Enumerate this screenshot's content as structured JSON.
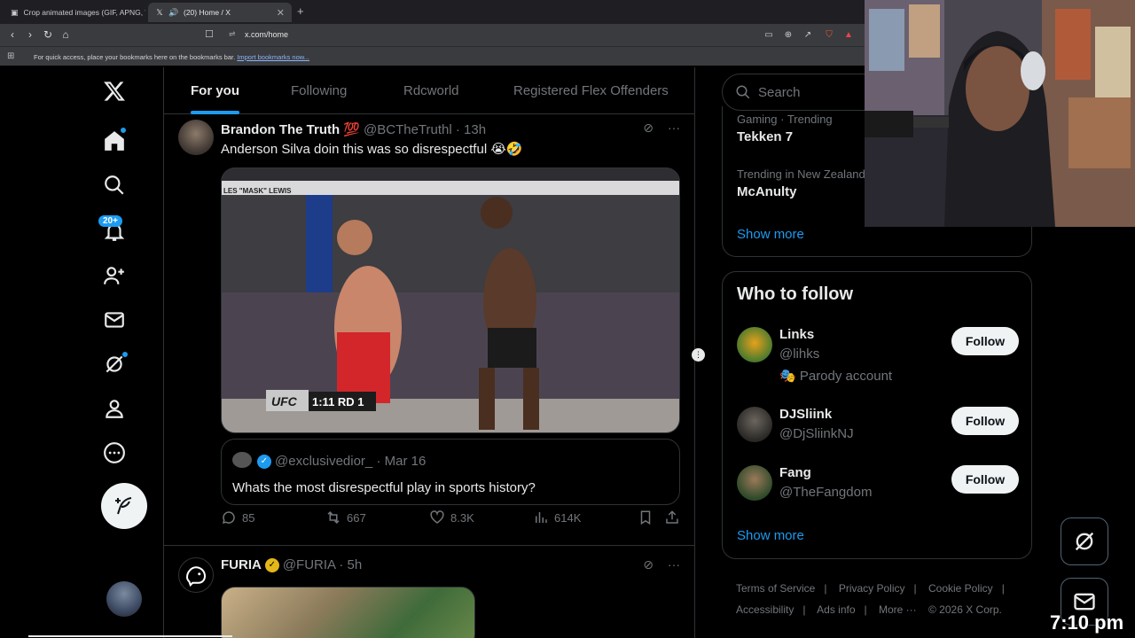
{
  "browser": {
    "tabs": [
      {
        "title": "Crop animated images (GIF, APNG, W..."
      },
      {
        "title": "(20) Home / X"
      }
    ],
    "new_tab_label": "+",
    "url": "x.com/home",
    "bookmarks_bar": {
      "message": "For quick access, place your bookmarks here on the bookmarks bar.",
      "link": "Import bookmarks now..."
    }
  },
  "nav": {
    "notification_count": "20+"
  },
  "timeline": {
    "tabs": [
      {
        "label": "For you"
      },
      {
        "label": "Following"
      },
      {
        "label": "Rdcworld"
      },
      {
        "label": "Registered Flex Offenders"
      }
    ],
    "posts": [
      {
        "name": "Brandon The Truth 💯",
        "handle": "@BCTheTruthl · 13h",
        "text": "Anderson Silva doin this was so disrespectful 😭🤣",
        "video_overlay": {
          "banner": "LES \"MASK\" LEWIS",
          "score": "1:11 RD 1",
          "brand": "UFC"
        },
        "quote": {
          "handle": "@exclusivedior_ · Mar 16",
          "text": "Whats the most disrespectful play in sports history?"
        },
        "stats": {
          "replies": "85",
          "reposts": "667",
          "likes": "8.3K",
          "views": "614K"
        }
      },
      {
        "name": "FURIA",
        "handle": "@FURIA · 5h"
      }
    ]
  },
  "sidebar": {
    "search_placeholder": "Search",
    "trends": [
      {
        "meta": "Gaming · Trending",
        "name": "Tekken 7"
      },
      {
        "meta": "Trending in New Zealand",
        "name": "McAnulty"
      }
    ],
    "trends_show_more": "Show more",
    "who_to_follow": {
      "title": "Who to follow",
      "items": [
        {
          "name": "Links",
          "handle": "@lihks",
          "extra": "🎭 Parody account",
          "button": "Follow"
        },
        {
          "name": "DJSliink",
          "handle": "@DjSliinkNJ",
          "button": "Follow"
        },
        {
          "name": "Fang",
          "handle": "@TheFangdom",
          "button": "Follow"
        }
      ],
      "show_more": "Show more"
    },
    "footer": [
      "Terms of Service",
      "|",
      "Privacy Policy",
      "|",
      "Cookie Policy",
      "|",
      "Accessibility",
      "|",
      "Ads info",
      "|",
      "More ···",
      "© 2026 X Corp."
    ]
  },
  "overlay": {
    "clock": "7:10 pm"
  },
  "colors": {
    "accent": "#1d9bf0",
    "background": "#000000",
    "border": "#2f3336",
    "muted": "#71767b"
  }
}
